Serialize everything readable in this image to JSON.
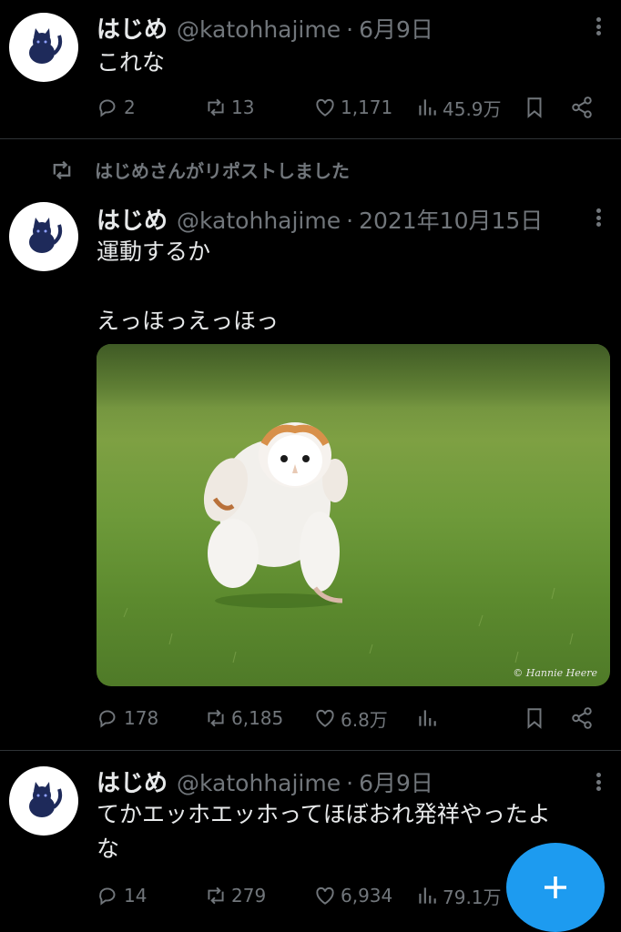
{
  "tweets": [
    {
      "name": "はじめ",
      "handle": "@katohhajime",
      "dot": "·",
      "date": "6月9日",
      "text": "これな",
      "replies": "2",
      "reposts": "13",
      "likes": "1,171",
      "views": "45.9万"
    },
    {
      "repost_notice": "はじめさんがリポストしました",
      "name": "はじめ",
      "handle": "@katohhajime",
      "dot": "·",
      "date": "2021年10月15日",
      "text_line1": "運動するか",
      "text_line2": "えっほっえっほっ",
      "photo_credit": "© Hannie Heere",
      "replies": "178",
      "reposts": "6,185",
      "likes": "6.8万"
    },
    {
      "name": "はじめ",
      "handle": "@katohhajime",
      "dot": "·",
      "date": "6月9日",
      "text_line1": "てかエッホエッホってほぼおれ発祥やったよ",
      "text_line2": "な",
      "replies": "14",
      "reposts": "279",
      "likes": "6,934",
      "views": "79.1万"
    }
  ],
  "fab": {
    "icon": "plus-icon",
    "color": "#1d9bf0"
  },
  "colors": {
    "background": "#000000",
    "text": "#e7e9ea",
    "muted": "#71767b",
    "accent": "#1d9bf0"
  }
}
